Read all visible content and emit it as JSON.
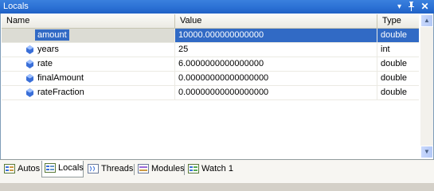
{
  "window": {
    "title": "Locals",
    "dropdown_glyph": "▾",
    "pin_glyph": "ᵖ",
    "close_glyph": "✕"
  },
  "columns": {
    "name": "Name",
    "value": "Value",
    "type": "Type"
  },
  "rows": [
    {
      "name": "amount",
      "value": "10000.000000000000",
      "type": "double",
      "selected": true
    },
    {
      "name": "years",
      "value": "25",
      "type": "int",
      "selected": false
    },
    {
      "name": "rate",
      "value": "6.0000000000000000",
      "type": "double",
      "selected": false
    },
    {
      "name": "finalAmount",
      "value": "0.00000000000000000",
      "type": "double",
      "selected": false
    },
    {
      "name": "rateFraction",
      "value": "0.00000000000000000",
      "type": "double",
      "selected": false
    }
  ],
  "tabs": [
    {
      "label": "Autos",
      "icon": "autos-icon"
    },
    {
      "label": "Locals",
      "icon": "locals-icon",
      "active": true
    },
    {
      "label": "Threads",
      "icon": "threads-icon"
    },
    {
      "label": "Modules",
      "icon": "modules-icon"
    },
    {
      "label": "Watch 1",
      "icon": "watch-icon"
    }
  ],
  "colors": {
    "titlebar": "#2a6fd3",
    "selection": "#316ac5",
    "variable_icon": "#3a6fd8"
  }
}
